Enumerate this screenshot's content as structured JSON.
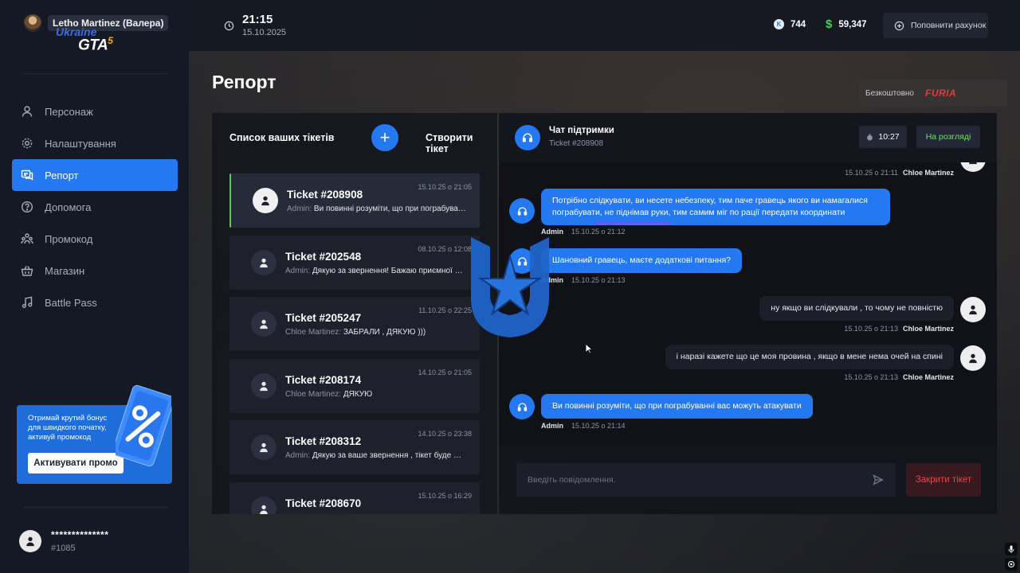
{
  "player": {
    "name": "Letho Martinez (Валера)"
  },
  "logo": {
    "top": "Ukraine",
    "main": "GTA",
    "sup": "5"
  },
  "topbar": {
    "time": "21:15",
    "date": "15.10.2025",
    "coins": "744",
    "money": "59,347",
    "topup_label": "Поповнити рахунок"
  },
  "page_title": "Репорт",
  "nav": [
    {
      "label": "Персонаж",
      "icon": "user-icon"
    },
    {
      "label": "Налаштування",
      "icon": "gear-icon"
    },
    {
      "label": "Репорт",
      "icon": "chat-icon"
    },
    {
      "label": "Допомога",
      "icon": "help-icon"
    },
    {
      "label": "Промокод",
      "icon": "people-icon"
    },
    {
      "label": "Магазин",
      "icon": "basket-icon"
    },
    {
      "label": "Battle Pass",
      "icon": "music-icon"
    }
  ],
  "promo": {
    "text": "Отримай крутий бонус для швидкого початку, активуй промокод",
    "button": "Активувати промо"
  },
  "user": {
    "name": "**************",
    "id": "#1085"
  },
  "free_badge": {
    "label": "Безкоштовно",
    "brand": "FURIA"
  },
  "tickets_panel": {
    "title": "Список ваших тікетів",
    "create_label": "Створити тікет",
    "tickets": [
      {
        "title": "Ticket #208908",
        "time": "15.10.25 о 21:05",
        "author": "Admin:",
        "message": "Ви повинні розуміти, що при пограбуванні вас можуть атакувати"
      },
      {
        "title": "Ticket #202548",
        "time": "08.10.25 о 12:08",
        "author": "Admin:",
        "message": "Дякую за звернення! Бажаю приємної гри"
      },
      {
        "title": "Ticket #205247",
        "time": "11.10.25 о 22:25",
        "author": "Chloe Martinez:",
        "message": "ЗАБРАЛИ , ДЯКУЮ )))"
      },
      {
        "title": "Ticket #208174",
        "time": "14.10.25 о 21:05",
        "author": "Chloe Martinez:",
        "message": "ДЯКУЮ"
      },
      {
        "title": "Ticket #208312",
        "time": "14.10.25 о 23:38",
        "author": "Admin:",
        "message": "Дякую за ваше звернення , тікет буде закрито"
      },
      {
        "title": "Ticket #208670",
        "time": "15.10.25 о 16:29",
        "author": "",
        "message": ""
      }
    ]
  },
  "chat": {
    "title": "Чат підтримки",
    "ticket": "Ticket #208908",
    "timer": "10:27",
    "status": "На розгляді",
    "messages": [
      {
        "from": "user",
        "text": "",
        "time": "15.10.25 о 21:11",
        "name": "Chloe Martinez"
      },
      {
        "from": "admin",
        "text": "Потрібно слідкувати, ви несете небезпеку, тим паче гравець якого ви намагалися пограбувати, не піднімав руки, тим самим міг по рації передати координати",
        "time": "15.10.25 о 21:12",
        "name": "Admin"
      },
      {
        "from": "admin",
        "text": "Шановний гравець, маєте додаткові питання?",
        "time": "15.10.25 о 21:13",
        "name": "Admin"
      },
      {
        "from": "user",
        "text": "ну якщо ви слідкували , то чому не повністю",
        "time": "15.10.25 о 21:13",
        "name": "Chloe Martinez"
      },
      {
        "from": "user",
        "text": "і наразі кажете що це моя провина , якщо в мене нема очей на спині",
        "time": "15.10.25 о 21:13",
        "name": "Chloe Martinez"
      },
      {
        "from": "admin",
        "text": "Ви повинні розуміти, що при пограбуванні вас можуть атакувати",
        "time": "15.10.25 о 21:14",
        "name": "Admin"
      }
    ],
    "input_placeholder": "Введіть повідомлення.",
    "close_button": "Закрити тікет"
  },
  "colors": {
    "accent": "#2479f2",
    "status_green": "#6fe36b",
    "danger": "#e2474f",
    "highlight": "#5ec85a"
  }
}
